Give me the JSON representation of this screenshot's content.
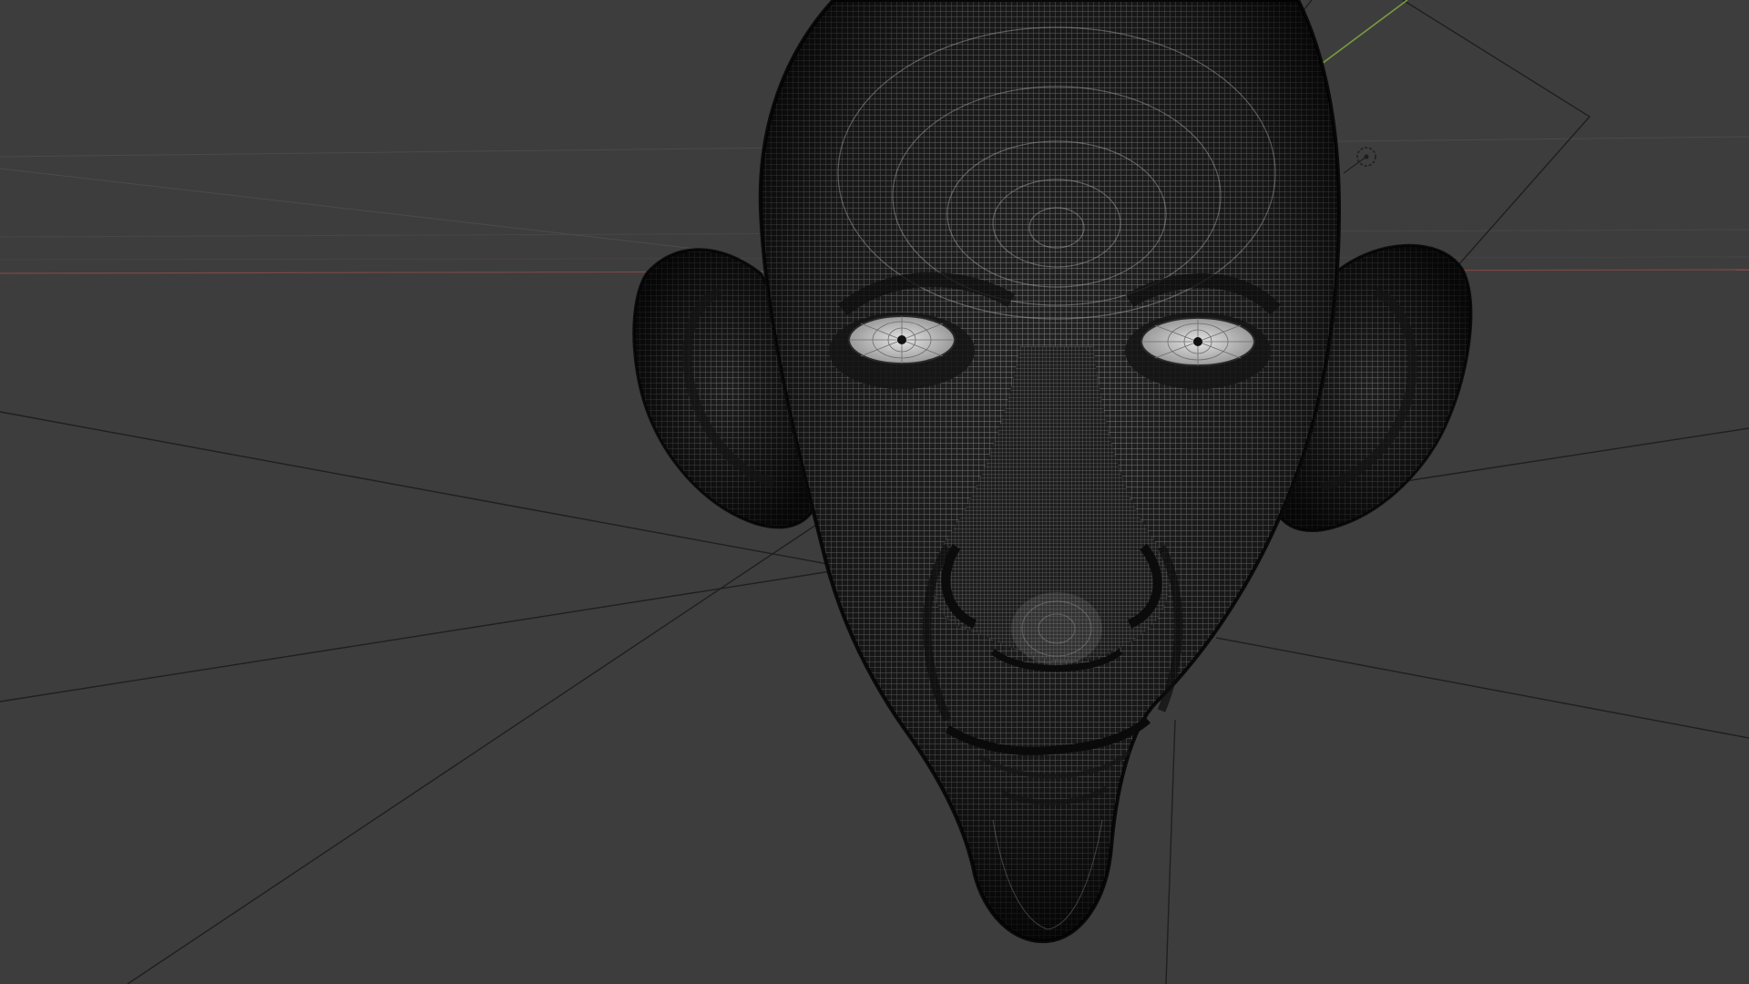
{
  "viewport": {
    "background_color": "#3d3d3d",
    "shading_mode": "wireframe",
    "object": "head-mesh"
  },
  "colors": {
    "mesh_dark": "#1b1b1b",
    "mesh_wire": "#8c8c8c",
    "mesh_highlight": "#bdbdbd",
    "eye_white": "#cfcfcf",
    "x_axis": "#8a4a4a",
    "y_axis": "#7a9a3c",
    "guide_line": "#1e1e1e",
    "grid_line": "#474747"
  },
  "icons": {
    "light_gizmo": "light-icon"
  }
}
